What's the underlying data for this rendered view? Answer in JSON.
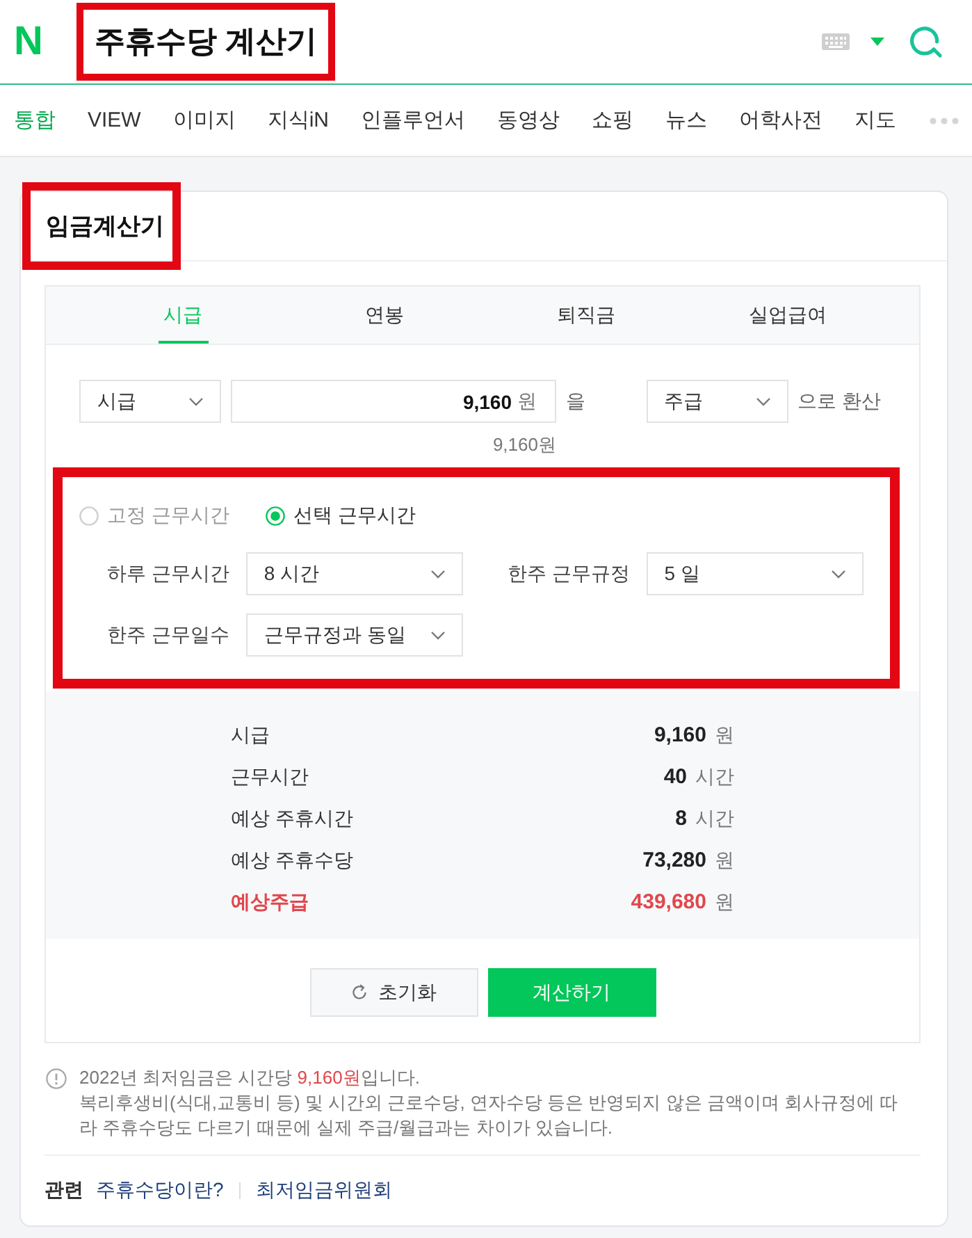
{
  "header": {
    "logo": "N",
    "search": {
      "value": "주휴수당 계산기",
      "highlighted": true
    }
  },
  "nav_tabs": [
    {
      "label": "통합",
      "selected": true
    },
    {
      "label": "VIEW",
      "selected": false
    },
    {
      "label": "이미지",
      "selected": false
    },
    {
      "label": "지식iN",
      "selected": false
    },
    {
      "label": "인플루언서",
      "selected": false
    },
    {
      "label": "동영상",
      "selected": false
    },
    {
      "label": "쇼핑",
      "selected": false
    },
    {
      "label": "뉴스",
      "selected": false
    },
    {
      "label": "어학사전",
      "selected": false
    },
    {
      "label": "지도",
      "selected": false
    }
  ],
  "calculator": {
    "title": "임금계산기",
    "title_highlighted": true,
    "tabs": [
      {
        "label": "시급",
        "selected": true
      },
      {
        "label": "연봉",
        "selected": false
      },
      {
        "label": "퇴직금",
        "selected": false
      },
      {
        "label": "실업급여",
        "selected": false
      }
    ],
    "converter": {
      "from_unit": "시급",
      "amount": "9,160",
      "amount_unit": "원",
      "particle": "을",
      "to_unit": "주급",
      "suffix": "으로 환산",
      "preview": "9,160원"
    },
    "work_hours": {
      "highlighted": true,
      "modes": [
        {
          "label": "고정 근무시간",
          "selected": false
        },
        {
          "label": "선택 근무시간",
          "selected": true
        }
      ],
      "fields": [
        {
          "label": "하루 근무시간",
          "value": "8 시간"
        },
        {
          "label": "한주 근무규정",
          "value": "5 일"
        },
        {
          "label": "한주 근무일수",
          "value": "근무규정과 동일"
        }
      ]
    },
    "results": [
      {
        "label": "시급",
        "value": "9,160",
        "unit": "원",
        "emphasized": false
      },
      {
        "label": "근무시간",
        "value": "40",
        "unit": "시간",
        "emphasized": false
      },
      {
        "label": "예상 주휴시간",
        "value": "8",
        "unit": "시간",
        "emphasized": false
      },
      {
        "label": "예상 주휴수당",
        "value": "73,280",
        "unit": "원",
        "emphasized": false
      },
      {
        "label": "예상주급",
        "value": "439,680",
        "unit": "원",
        "emphasized": true
      }
    ],
    "buttons": [
      {
        "label": "초기화",
        "kind": "reset"
      },
      {
        "label": "계산하기",
        "kind": "submit"
      }
    ]
  },
  "notice": {
    "lead": "2022년 최저임금은 시간당 ",
    "amount": "9,160원",
    "tail": "입니다.",
    "detail": "복리후생비(식대,교통비 등) 및 시간외 근로수당, 연자수당 등은 반영되지 않은 금액이며 회사규정에 따라 주휴수당도 다르기 때문에 실제 주급/월급과는 차이가 있습니다."
  },
  "related": {
    "label": "관련",
    "links": [
      "주휴수당이란?",
      "최저임금위원회"
    ]
  }
}
